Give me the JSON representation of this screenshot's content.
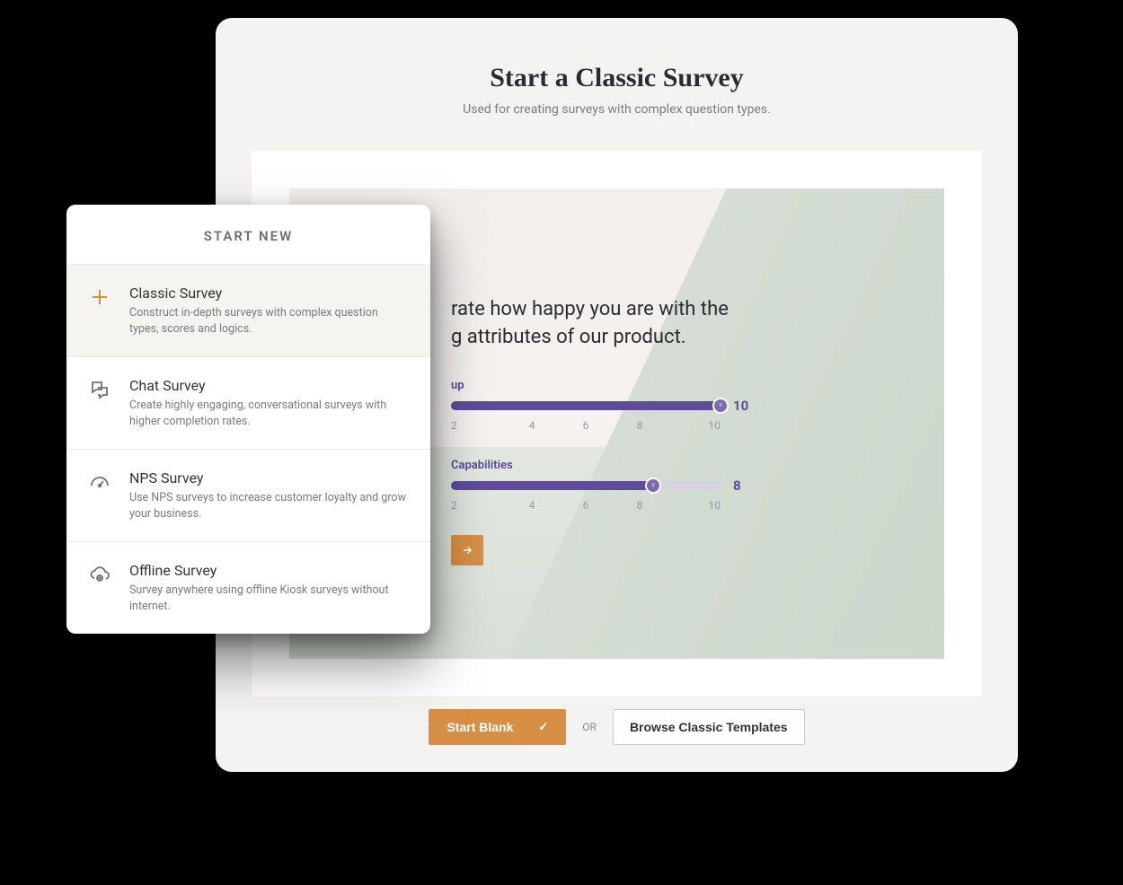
{
  "main": {
    "title": "Start a Classic Survey",
    "subtitle": "Used for creating surveys with complex question types."
  },
  "preview": {
    "question_line1": "rate how happy you are with the",
    "question_line2": "g attributes of our product.",
    "sliders": [
      {
        "label": "up",
        "value": 10,
        "max": 10,
        "ticks": [
          "2",
          "4",
          "6",
          "8",
          "10"
        ]
      },
      {
        "label": "Capabilities",
        "value": 8,
        "max": 10,
        "ticks": [
          "2",
          "4",
          "6",
          "8",
          "10"
        ]
      }
    ]
  },
  "footer": {
    "start_blank": "Start Blank",
    "or": "OR",
    "browse": "Browse Classic Templates"
  },
  "popover": {
    "header": "START NEW",
    "options": [
      {
        "title": "Classic Survey",
        "desc": "Construct in-depth surveys with complex question types, scores and logics."
      },
      {
        "title": "Chat Survey",
        "desc": "Create highly engaging, conversational surveys with higher completion rates."
      },
      {
        "title": "NPS Survey",
        "desc": "Use NPS surveys to increase customer loyalty and grow your business."
      },
      {
        "title": "Offline Survey",
        "desc": "Survey anywhere using offline Kiosk surveys without internet."
      }
    ]
  }
}
